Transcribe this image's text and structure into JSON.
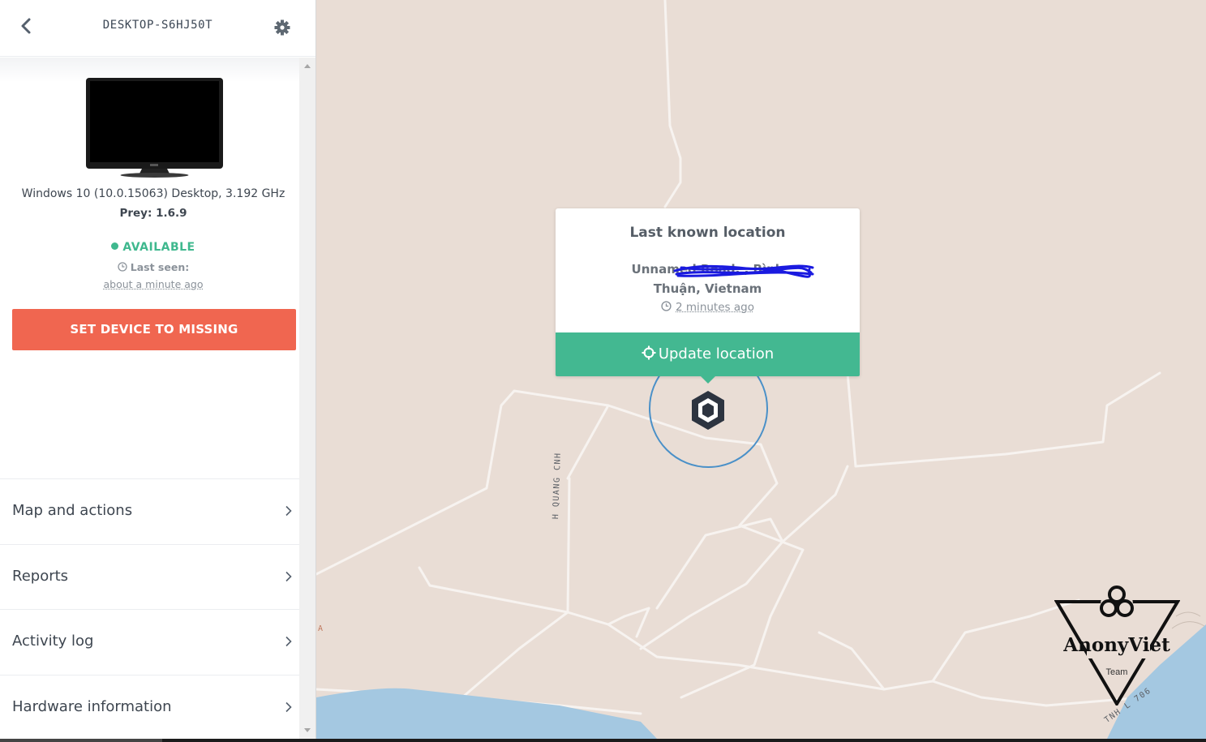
{
  "header": {
    "device_name": "DESKTOP-S6HJ50T"
  },
  "device": {
    "os_info": "Windows 10 (10.0.15063) Desktop, 3.192 GHz",
    "prey_version": "Prey: 1.6.9",
    "status": "AVAILABLE",
    "last_seen_label": "Last seen:",
    "last_seen_time": "about a minute ago",
    "missing_button": "SET DEVICE TO MISSING"
  },
  "menu": {
    "items": [
      {
        "label": "Map and actions"
      },
      {
        "label": "Reports"
      },
      {
        "label": "Activity log"
      },
      {
        "label": "Hardware information"
      }
    ]
  },
  "map": {
    "road_label": "H QUANG CNH",
    "road_label_2": "TNH L 706",
    "edge_letter": "A",
    "popup": {
      "title": "Last known location",
      "address_line1": "Unnamed Road,                         , Bình",
      "address_line2": "Thuận, Vietnam",
      "time": "2 minutes ago",
      "update_button": "Update location"
    },
    "watermark": {
      "name": "AnonyViet",
      "team": "Team"
    }
  },
  "colors": {
    "available": "#3fb88e",
    "missing": "#f06650",
    "update": "#43b891",
    "map_land": "#e9ddd5",
    "map_water": "#a4c8e1"
  }
}
